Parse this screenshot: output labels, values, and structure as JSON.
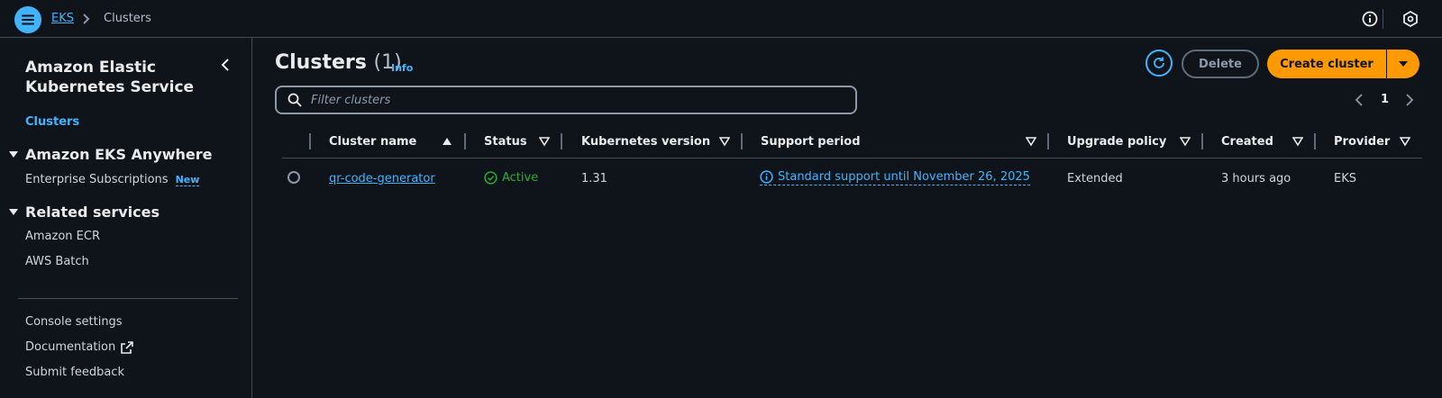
{
  "breadcrumb": {
    "root": "EKS",
    "current": "Clusters"
  },
  "sidebar": {
    "title": "Amazon Elastic Kubernetes Service",
    "active_item": "Clusters",
    "sections": [
      {
        "label": "Amazon EKS Anywhere",
        "items": [
          {
            "label": "Enterprise Subscriptions",
            "badge": "New"
          }
        ]
      },
      {
        "label": "Related services",
        "items": [
          {
            "label": "Amazon ECR"
          },
          {
            "label": "AWS Batch"
          }
        ]
      }
    ],
    "footer_items": [
      "Console settings",
      "Documentation",
      "Submit feedback"
    ]
  },
  "main": {
    "title": "Clusters",
    "count": "(1)",
    "info_label": "Info",
    "delete_label": "Delete",
    "create_label": "Create cluster",
    "filter_placeholder": "Filter clusters",
    "page_number": "1"
  },
  "table": {
    "columns": [
      "Cluster name",
      "Status",
      "Kubernetes version",
      "Support period",
      "Upgrade policy",
      "Created",
      "Provider"
    ],
    "rows": [
      {
        "name": "qr-code-generator",
        "status": "Active",
        "version": "1.31",
        "support": "Standard support until November 26, 2025",
        "upgrade_policy": "Extended",
        "created": "3 hours ago",
        "provider": "EKS"
      }
    ]
  },
  "colors": {
    "accent": "#42b4ff",
    "primary_button": "#ff9900",
    "success": "#29ad32",
    "background": "#0f141a"
  },
  "icons": [
    "menu-icon",
    "chevron-right-icon",
    "info-icon",
    "settings-icon",
    "chevron-left-icon",
    "caret-down-icon",
    "external-link-icon",
    "refresh-icon",
    "search-icon",
    "sort-ascending-icon",
    "filter-caret-icon",
    "check-circle-icon"
  ]
}
